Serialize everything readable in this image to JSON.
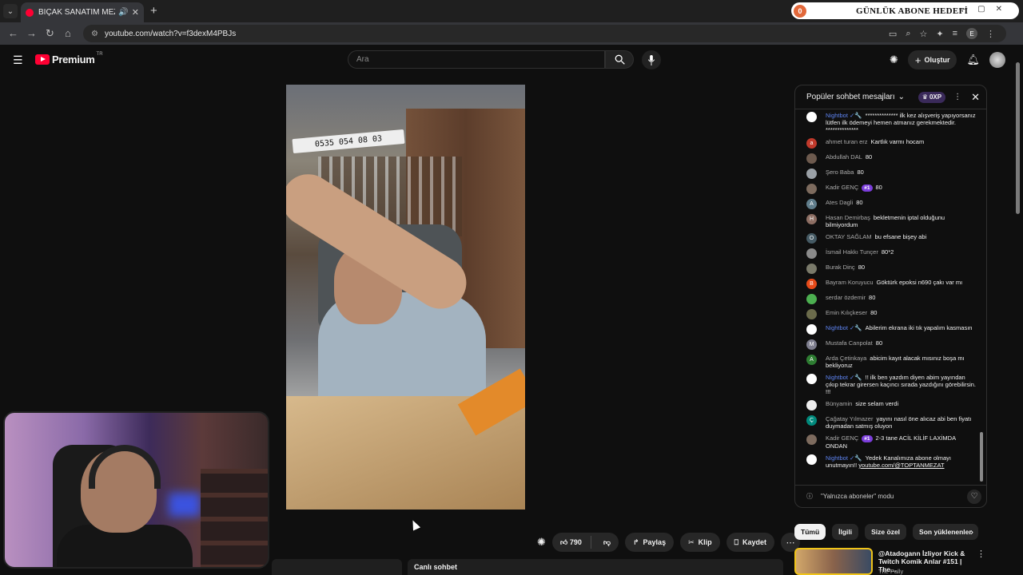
{
  "browser": {
    "tab_title": "BIÇAK SANATIM MEZAT ka",
    "url": "youtube.com/watch?v=f3dexM4PBJs",
    "profile_initial": "E"
  },
  "overlay": {
    "count": "0",
    "label": "GÜNLÜK ABONE HEDEFİ"
  },
  "header": {
    "logo_text": "Premium",
    "country": "TR",
    "search_placeholder": "Ara",
    "create_label": "Oluştur"
  },
  "video": {
    "sign_text": "0535 054 08 03"
  },
  "actions": {
    "likes": "790",
    "share": "Paylaş",
    "clip": "Klip",
    "save": "Kaydet"
  },
  "chat": {
    "title": "Popüler sohbet mesajları",
    "xp": "0XP",
    "footer": "\"Yalnızca aboneler\" modu",
    "messages": [
      {
        "name": "Nightbot ✓🔧",
        "mod": true,
        "avatar": "#ffffff",
        "initial": "",
        "text": "************** ilk kez alışveriş yapıyorsanız lütfen ilk ödemeyi hemen atmanız gerekmektedir. **************"
      },
      {
        "name": "ahmet turan erz",
        "avatar": "#c0392b",
        "initial": "a",
        "text": "Kartlık varmı hocam"
      },
      {
        "name": "Abdullah DAL",
        "avatar": "#6d5a4e",
        "initial": "",
        "text": "80"
      },
      {
        "name": "Şero Baba",
        "avatar": "#9aa0a6",
        "initial": "",
        "text": "80"
      },
      {
        "name": "Kadir GENÇ",
        "avatar": "#7d6b5e",
        "initial": "",
        "badge": "#1",
        "text": "80"
      },
      {
        "name": "Ates Dagli",
        "avatar": "#607d8b",
        "initial": "A",
        "text": "80"
      },
      {
        "name": "Hasan Demirbaş",
        "avatar": "#8d6e63",
        "initial": "H",
        "text": "bekletmenin iptal olduğunu bilmiyordum"
      },
      {
        "name": "OKTAY SAĞLAM",
        "avatar": "#455a64",
        "initial": "O",
        "text": "bu efsane bişey abi"
      },
      {
        "name": "İsmail Hakkı Tunçer",
        "avatar": "#8a8a8a",
        "initial": "",
        "text": "80*2"
      },
      {
        "name": "Burak Dinç",
        "avatar": "#7a7a6a",
        "initial": "",
        "text": "80"
      },
      {
        "name": "Bayram Koruyucu",
        "avatar": "#e64a19",
        "initial": "B",
        "text": "Göktürk epoksi n690 çakı var mı"
      },
      {
        "name": "serdar özdemir",
        "avatar": "#4caf50",
        "initial": "",
        "text": "80"
      },
      {
        "name": "Emin Kılıçkeser",
        "avatar": "#6b6b4b",
        "initial": "",
        "text": "80"
      },
      {
        "name": "Nightbot ✓🔧",
        "mod": true,
        "avatar": "#ffffff",
        "initial": "",
        "text": "Abilerim ekrana iki tık yapalım kasmasın"
      },
      {
        "name": "Mustafa Canpolat",
        "avatar": "#7e7e8e",
        "initial": "M",
        "text": "80"
      },
      {
        "name": "Arda Çetinkaya",
        "avatar": "#2e7d32",
        "initial": "A",
        "text": "abicim kayıt alacak mısınız boşa mı bekliyoruz"
      },
      {
        "name": "Nightbot ✓🔧",
        "mod": true,
        "avatar": "#ffffff",
        "initial": "",
        "text": "!! ilk ben yazdım diyen abim yayından çıkıp tekrar girersen kaçıncı sırada yazdığını görebilirsin. !!!"
      },
      {
        "name": "Bünyamin",
        "avatar": "#eeeeee",
        "initial": "",
        "text": "size selam verdi"
      },
      {
        "name": "Çağatay Yılmazer",
        "avatar": "#00897b",
        "initial": "Ç",
        "text": "yayını nasıl öne alıcaz abi ben fiyatı duymadan satmış oluyon"
      },
      {
        "name": "Kadir GENÇ",
        "avatar": "#7d6b5e",
        "initial": "",
        "badge": "#1",
        "text": "2-3 tane ACİL KİLİF LAXİMDA ONDAN"
      },
      {
        "name": "Nightbot ✓🔧",
        "mod": true,
        "avatar": "#ffffff",
        "initial": "",
        "text": "Yedek Kanalımıza abone olmayı unutmayın!!",
        "link": "youtube.com/@TOPTANMEZAT"
      }
    ]
  },
  "chips": [
    "Tümü",
    "İlgili",
    "Size özel",
    "Son yüklenenler"
  ],
  "recommendation": {
    "title": "@Atadogann İzliyor Kick & Twitch Komik Anlar #151 | The...",
    "channel": "The Pally"
  },
  "below": {
    "live_chat_label": "Canlı sohbet"
  },
  "colors": {
    "accent": "#ff0033",
    "mod_name": "#5e84f1",
    "badge": "#7b3ddb"
  }
}
